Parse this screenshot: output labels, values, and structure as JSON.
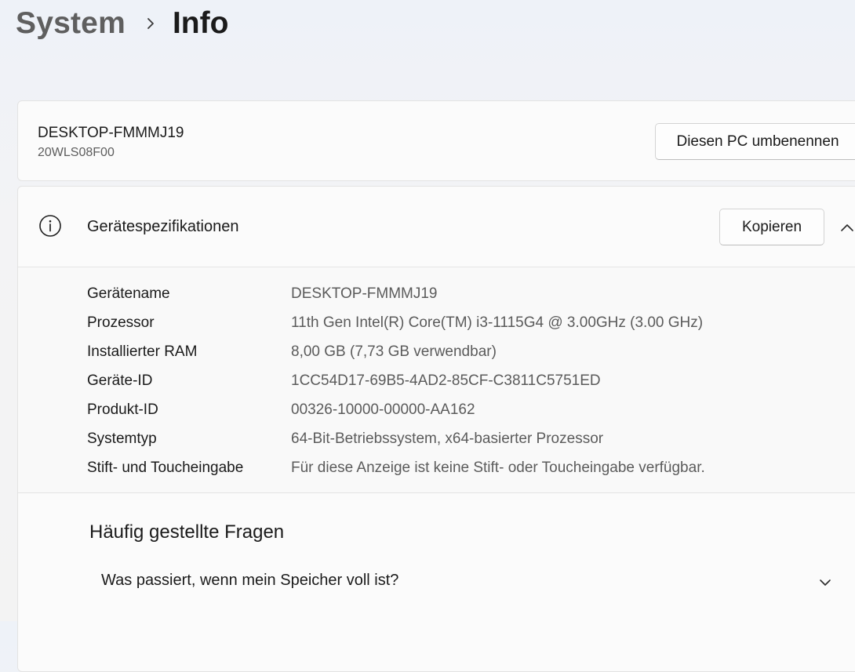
{
  "breadcrumb": {
    "parent": "System",
    "current": "Info"
  },
  "device_card": {
    "device_name": "DESKTOP-FMMMJ19",
    "model": "20WLS08F00",
    "rename_button": "Diesen PC umbenennen"
  },
  "specs": {
    "title": "Gerätespezifikationen",
    "copy_button": "Kopieren",
    "rows": [
      {
        "label": "Gerätename",
        "value": "DESKTOP-FMMMJ19"
      },
      {
        "label": "Prozessor",
        "value": "11th Gen Intel(R) Core(TM) i3-1115G4 @ 3.00GHz (3.00 GHz)"
      },
      {
        "label": "Installierter RAM",
        "value": "8,00 GB (7,73 GB verwendbar)"
      },
      {
        "label": "Geräte-ID",
        "value": "1CC54D17-69B5-4AD2-85CF-C3811C5751ED"
      },
      {
        "label": "Produkt-ID",
        "value": "00326-10000-00000-AA162"
      },
      {
        "label": "Systemtyp",
        "value": "64-Bit-Betriebssystem, x64-basierter Prozessor"
      },
      {
        "label": "Stift- und Toucheingabe",
        "value": "Für diese Anzeige ist keine Stift- oder Toucheingabe verfügbar."
      }
    ]
  },
  "faq": {
    "title": "Häufig gestellte Fragen",
    "items": [
      {
        "question": "Was passiert, wenn mein Speicher voll ist?"
      }
    ]
  },
  "icons": {
    "breadcrumb_separator": "chevron-right-icon",
    "spec_section": "info-icon",
    "collapse": "chevron-up-icon",
    "expand": "chevron-down-icon"
  }
}
